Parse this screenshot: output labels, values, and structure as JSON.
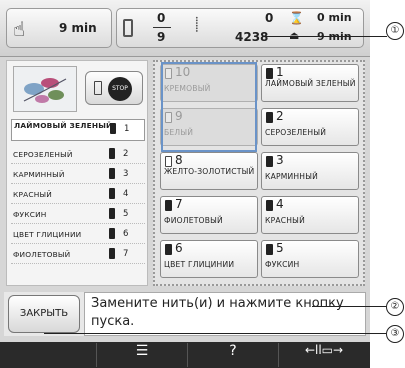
{
  "topbar": {
    "total_time": "9 min",
    "color_current": "0",
    "color_total": "9",
    "stitch_current": "0",
    "stitch_total": "4238",
    "time_remaining": "0 min",
    "time_total": "9 min"
  },
  "sequence": [
    {
      "label": "ЛАЙМОВЫЙ ЗЕЛЕНЫЙ",
      "num": "1"
    },
    {
      "label": "СЕРОЗЕЛЕНЫЙ",
      "num": "2"
    },
    {
      "label": "КАРМИННЫЙ",
      "num": "3"
    },
    {
      "label": "КРАСНЫЙ",
      "num": "4"
    },
    {
      "label": "ФУКСИН",
      "num": "5"
    },
    {
      "label": "ЦВЕТ ГЛИЦИНИИ",
      "num": "6"
    },
    {
      "label": "ФИОЛЕТОВЫЙ",
      "num": "7"
    }
  ],
  "needles": [
    {
      "num": "10",
      "label": "КРЕМОВЫЙ"
    },
    {
      "num": "1",
      "label": "ЛАЙМОВЫЙ ЗЕЛЕНЫЙ"
    },
    {
      "num": "9",
      "label": "БЕЛЫЙ"
    },
    {
      "num": "2",
      "label": "СЕРОЗЕЛЕНЫЙ"
    },
    {
      "num": "8",
      "label": "ЖЕЛТО-ЗОЛОТИСТЫЙ"
    },
    {
      "num": "3",
      "label": "КАРМИННЫЙ"
    },
    {
      "num": "7",
      "label": "ФИОЛЕТОВЫЙ"
    },
    {
      "num": "4",
      "label": "КРАСНЫЙ"
    },
    {
      "num": "6",
      "label": "ЦВЕТ ГЛИЦИНИИ"
    },
    {
      "num": "5",
      "label": "ФУКСИН"
    }
  ],
  "buttons": {
    "close": "ЗАКРЫТЬ",
    "stop": "STOP"
  },
  "message": "Замените нить(и) и нажмите кнопку пуска.",
  "callouts": [
    "①",
    "②",
    "③"
  ],
  "icons": {
    "total_time": "hand-stitch-icon",
    "color": "spool-icon",
    "stitch": "stitch-count-icon",
    "time": "hourglass-icon",
    "design": "embroidery-thumbnail",
    "stop": "stop-icon",
    "bottom": [
      "blank",
      "color-list-icon",
      "help-icon",
      "thread-cut-icon"
    ]
  }
}
